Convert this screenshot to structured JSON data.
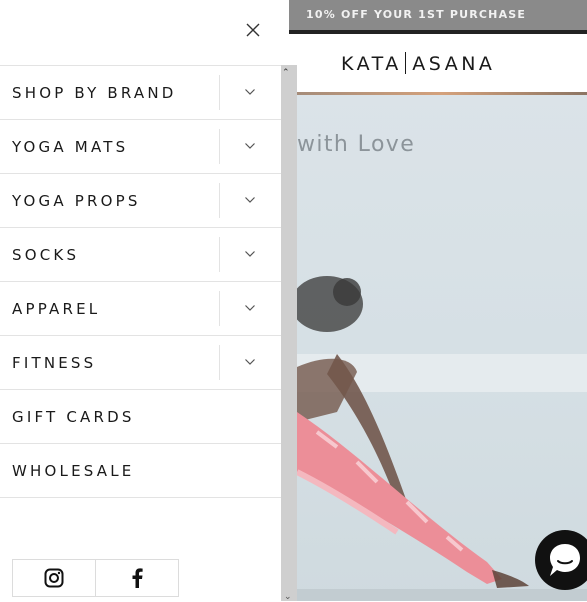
{
  "promo": {
    "text": "10% OFF YOUR 1ST PURCHASE"
  },
  "brand": {
    "left": "KATA",
    "right": "ASANA"
  },
  "hero": {
    "heading": "with Love"
  },
  "drawer": {
    "close_icon": "close-icon",
    "menu": [
      {
        "label": "SHOP BY BRAND",
        "expandable": true
      },
      {
        "label": "YOGA MATS",
        "expandable": true
      },
      {
        "label": "YOGA PROPS",
        "expandable": true
      },
      {
        "label": "SOCKS",
        "expandable": true
      },
      {
        "label": "APPAREL",
        "expandable": true
      },
      {
        "label": "FITNESS",
        "expandable": true
      },
      {
        "label": "GIFT CARDS",
        "expandable": false
      },
      {
        "label": "WHOLESALE",
        "expandable": false
      }
    ],
    "social": [
      {
        "icon": "instagram-icon"
      },
      {
        "icon": "facebook-icon"
      }
    ]
  },
  "chat": {
    "icon": "chat-icon"
  },
  "colors": {
    "text": "#1a1a1a",
    "divider": "#e3e3e3",
    "promo_bg": "#8a8a8a"
  }
}
